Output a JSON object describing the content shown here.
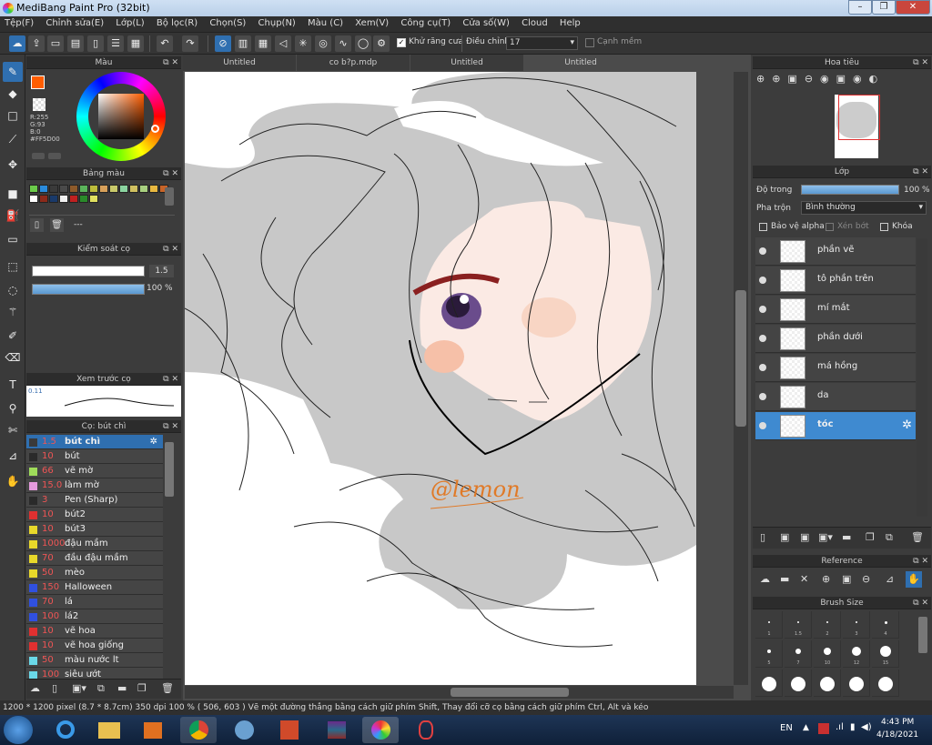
{
  "window": {
    "title": "MediBang Paint Pro (32bit)",
    "controls": [
      "–",
      "❐",
      "✕"
    ]
  },
  "menu": [
    "Tệp(F)",
    "Chỉnh sửa(E)",
    "Lớp(L)",
    "Bộ lọc(R)",
    "Chọn(S)",
    "Chụp(N)",
    "Màu (C)",
    "Xem(V)",
    "Công cụ(T)",
    "Cửa số(W)",
    "Cloud",
    "Help"
  ],
  "toolbar": {
    "antialias_label": "Khử răng cưa",
    "adjust_label": "Điều chỉnh",
    "adjust_value": "17",
    "soft_edge_label": "Cạnh mềm"
  },
  "tabs": [
    "Untitled",
    "co b?p.mdp",
    "Untitled",
    "Untitled"
  ],
  "color_panel": {
    "title": "Màu",
    "fg_color": "#FF5D00",
    "r": "R:255",
    "g": "G:93",
    "b": "B:0",
    "hex": "#FF5D00"
  },
  "palette_panel": {
    "title": "Bảng màu",
    "colors": [
      "#6bcb4a",
      "#2a8bdc",
      "#3a3a3a",
      "#4a4a4a",
      "#8e5a2a",
      "#5bb45b",
      "#bdbd3b",
      "#d8a05a",
      "#c9c96a",
      "#8bd4a0",
      "#d0c060",
      "#a8d080",
      "#e8b840",
      "#c86428",
      "#ffffff",
      "#8c2a1a",
      "#1a3a6a",
      "#f0f0f0",
      "#c02020",
      "#2a8a2a",
      "#e0e060"
    ],
    "none_label": "---"
  },
  "brush_control": {
    "title": "Kiểm soát cọ",
    "size_value": "1.5",
    "opacity_value": "100 %"
  },
  "preview": {
    "title": "Xem trước cọ",
    "size_label": "0.11"
  },
  "brush_list": {
    "title": "Cọ: bút chì",
    "items": [
      {
        "size": "1.5",
        "name": "bút chì",
        "color": "#3a3a3a"
      },
      {
        "size": "10",
        "name": "bút",
        "color": "#2a2a2a"
      },
      {
        "size": "66",
        "name": "vẽ mờ",
        "color": "#9fdc5a"
      },
      {
        "size": "15.0",
        "name": "làm mờ",
        "color": "#e49adc"
      },
      {
        "size": "3",
        "name": "Pen (Sharp)",
        "color": "#2a2a2a"
      },
      {
        "size": "10",
        "name": "bút2",
        "color": "#e03030"
      },
      {
        "size": "10",
        "name": "bút3",
        "color": "#e8d82a"
      },
      {
        "size": "1000",
        "name": "đậu mầm",
        "color": "#e8d82a"
      },
      {
        "size": "70",
        "name": "đầu đậu mầm",
        "color": "#e8d82a"
      },
      {
        "size": "50",
        "name": "mèo",
        "color": "#e8d82a"
      },
      {
        "size": "150",
        "name": "Halloween",
        "color": "#3050e0"
      },
      {
        "size": "70",
        "name": "lá",
        "color": "#3050e0"
      },
      {
        "size": "100",
        "name": "lá2",
        "color": "#3050e0"
      },
      {
        "size": "10",
        "name": "vẽ hoa",
        "color": "#e03030"
      },
      {
        "size": "10",
        "name": "vẽ hoa giống",
        "color": "#e03030"
      },
      {
        "size": "50",
        "name": "màu nước lt",
        "color": "#6ad8e8"
      },
      {
        "size": "100",
        "name": "siêu ướt",
        "color": "#6ad8e8"
      }
    ]
  },
  "navigator": {
    "title": "Hoa tiêu"
  },
  "layers": {
    "title": "Lớp",
    "opacity_label": "Độ trong",
    "opacity_value": "100 %",
    "blend_label": "Pha trộn",
    "blend_value": "Bình thường",
    "protect_alpha": "Bảo vệ alpha",
    "clip": "Xén bớt",
    "lock": "Khóa",
    "items": [
      "phần vẽ",
      "tô phần trên",
      "mí mắt",
      "phần dưới",
      "má hồng",
      "da",
      "tóc"
    ],
    "selected": "tóc"
  },
  "reference": {
    "title": "Reference"
  },
  "brush_size": {
    "title": "Brush Size",
    "sizes": [
      "1",
      "1.5",
      "2",
      "3",
      "4",
      "5",
      "7",
      "10",
      "12",
      "15"
    ]
  },
  "canvas": {
    "signature": "@lemon"
  },
  "status": {
    "dimensions": "1200 * 1200 pixel",
    "cm": "(8.7 * 8.7cm)",
    "dpi": "350 dpi",
    "zoom": "100 %",
    "coords": "( 506, 603 )",
    "hint": "Vẽ một đường thẳng bằng cách giữ phím Shift, Thay đổi cỡ cọ bằng cách giữ phím Ctrl, Alt và kéo"
  },
  "taskbar": {
    "lang": "EN",
    "time": "4:43 PM",
    "date": "4/18/2021"
  }
}
